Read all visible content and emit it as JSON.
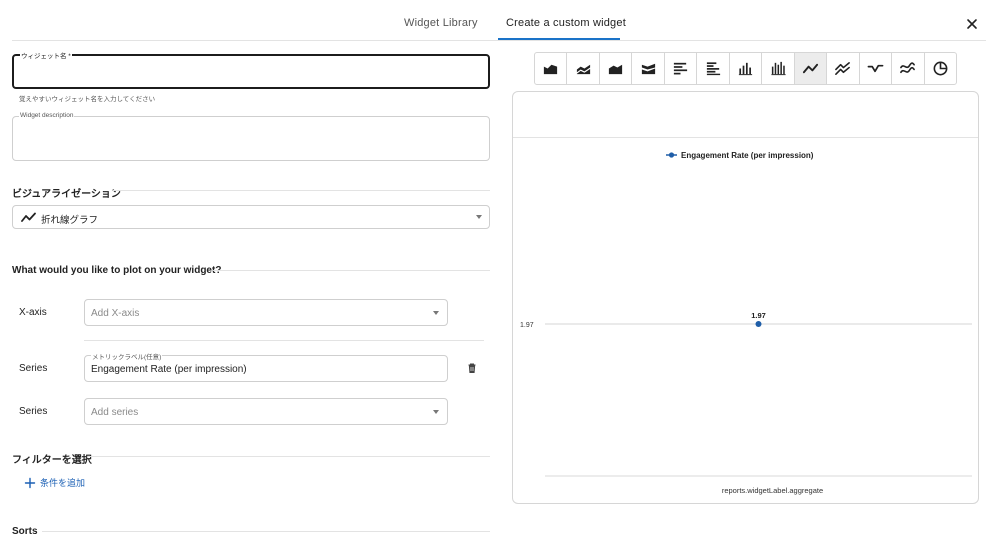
{
  "tabs": [
    {
      "label": "Widget Library"
    },
    {
      "label": "Create a custom widget"
    }
  ],
  "form": {
    "name_label": "ウィジェット名 *",
    "name_value": "",
    "name_helper": "覚えやすいウィジェット名を入力してください",
    "description_label": "Widget description",
    "description_value": ""
  },
  "visualization": {
    "title": "ビジュアライゼーション",
    "selected": "折れ線グラフ",
    "selected_icon": "line-chart-icon"
  },
  "plot": {
    "title": "What would you like to plot on your widget?",
    "xaxis_label": "X-axis",
    "xaxis_placeholder": "Add X-axis",
    "series1_label": "Series",
    "series1_field_label": "メトリックラベル(任意)",
    "series1_value": "Engagement Rate (per impression)",
    "series2_label": "Series",
    "series2_placeholder": "Add series"
  },
  "filters": {
    "title": "フィルターを選択",
    "add_condition": "条件を追加"
  },
  "sorts": {
    "title": "Sorts"
  },
  "chart_types": [
    {
      "icon": "area-chart-icon"
    },
    {
      "icon": "stacked-area-chart-icon"
    },
    {
      "icon": "step-area-chart-icon"
    },
    {
      "icon": "stream-area-chart-icon"
    },
    {
      "icon": "horizontal-bar-chart-icon"
    },
    {
      "icon": "stacked-horizontal-bar-chart-icon"
    },
    {
      "icon": "vertical-bar-chart-icon"
    },
    {
      "icon": "stacked-vertical-bar-chart-icon"
    },
    {
      "icon": "line-chart-icon",
      "selected": true
    },
    {
      "icon": "multi-line-chart-icon"
    },
    {
      "icon": "step-line-chart-icon"
    },
    {
      "icon": "smooth-line-chart-icon"
    },
    {
      "icon": "pie-chart-icon"
    }
  ],
  "colors": {
    "accent": "#1a73c8",
    "series": "#1f5ea8",
    "link": "#1a5fb4"
  },
  "chart_data": {
    "type": "line",
    "series": [
      {
        "name": "Engagement Rate (per impression)",
        "values": [
          1.97
        ]
      }
    ],
    "categories": [
      ""
    ],
    "point_label": "1.97",
    "ytick_labels": [
      "1.97"
    ],
    "xlabel": "reports.widgetLabel.aggregate",
    "ylabel": "",
    "legend": "top-center",
    "grid": false
  }
}
